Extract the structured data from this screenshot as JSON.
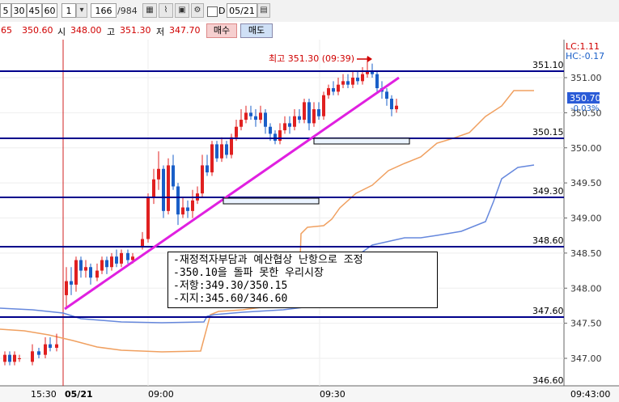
{
  "toolbar": {
    "periods": [
      "5",
      "30",
      "45",
      "60"
    ],
    "multiplier": "1",
    "count": "166",
    "total": "/984",
    "checkbox_label": "D",
    "date": "05/21"
  },
  "quote": {
    "change": "65",
    "last": "350.60",
    "open_label": "시",
    "open": "348.00",
    "high_label": "고",
    "high": "351.30",
    "low_label": "저",
    "low": "347.70",
    "buy_label": "매수",
    "sell_label": "매도"
  },
  "chart": {
    "lc_label": "LC:1.11",
    "hc_label": "HC:-0.17",
    "high_annotation": "최고 351.30 (09:39)",
    "price_labels": [
      "351.00",
      "350.50",
      "350.00",
      "349.50",
      "349.00",
      "348.50",
      "348.00",
      "347.50",
      "347.00"
    ],
    "current_price": "350.70",
    "current_change": "-0.03%",
    "hline_labels": [
      "351.10",
      "350.15",
      "349.30",
      "348.60",
      "347.60",
      "346.60"
    ],
    "time_labels": [
      "15:30",
      "05/21",
      "09:00",
      "09:30"
    ],
    "time_right": "09:43:00",
    "annotation_lines": [
      "-재정적자부담과 예산협상 난항으로 조정",
      "-350.10을 돌파 못한 우리시장",
      "-저항:349.30/350.15",
      "-지지:345.60/346.60"
    ]
  },
  "colors": {
    "up": "#e02020",
    "down": "#1a5fc8",
    "hline": "#00008b",
    "trend": "#e020e0",
    "orange_line": "#f0a060",
    "blue_line": "#6688dd"
  }
}
